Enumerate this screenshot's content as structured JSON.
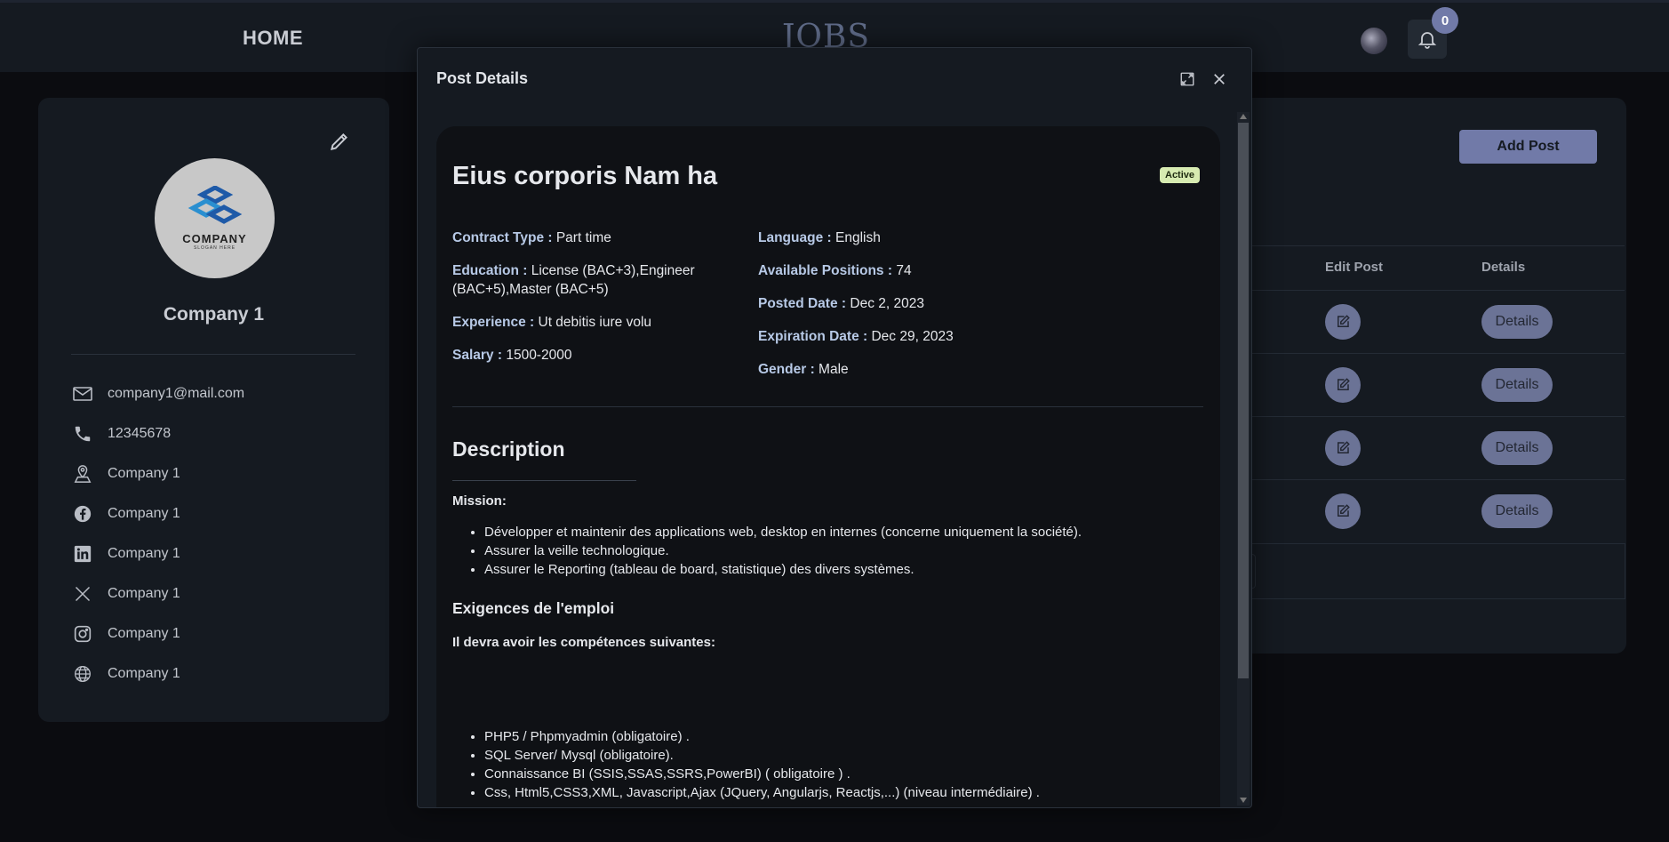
{
  "header": {
    "home_label": "HOME",
    "logo_text": "JOBS",
    "notification_count": "0"
  },
  "profile": {
    "company_name": "Company 1",
    "email": "company1@mail.com",
    "phone": "12345678",
    "address": "Company 1",
    "facebook": "Company 1",
    "linkedin": "Company 1",
    "x": "Company 1",
    "instagram": "Company 1",
    "website": "Company 1",
    "avatar_brand": "COMPANY",
    "avatar_slogan": "SLOGAN HERE"
  },
  "posts_panel": {
    "add_post_label": "Add Post",
    "columns": [
      "Edit Post",
      "Details"
    ],
    "rows": [
      {
        "details_label": "Details"
      },
      {
        "details_label": "Details"
      },
      {
        "details_label": "Details"
      },
      {
        "details_label": "Details"
      }
    ]
  },
  "modal": {
    "title": "Post Details",
    "post": {
      "title": "Eius corporis Nam ha",
      "status": "Active",
      "contract_type_label": "Contract Type :",
      "contract_type": "Part time",
      "education_label": "Education :",
      "education": "License (BAC+3),Engineer (BAC+5),Master (BAC+5)",
      "experience_label": "Experience :",
      "experience": "Ut debitis iure volu",
      "salary_label": "Salary :",
      "salary": "1500-2000",
      "language_label": "Language :",
      "language": "English",
      "positions_label": "Available Positions :",
      "positions": "74",
      "posted_label": "Posted Date :",
      "posted": "Dec 2, 2023",
      "expiration_label": "Expiration Date :",
      "expiration": "Dec 29, 2023",
      "gender_label": "Gender :",
      "gender": "Male"
    },
    "description": {
      "title": "Description",
      "mission_label": "Mission:",
      "mission_items": [
        "Développer et maintenir des applications web, desktop en internes (concerne uniquement la société).",
        "Assurer la veille technologique.",
        "Assurer le Reporting (tableau de board, statistique) des divers systèmes."
      ],
      "requirements_title": "Exigences de l'emploi",
      "skills_intro": "Il devra avoir les compétences suivantes:",
      "skills_items": [
        "PHP5 / Phpmyadmin (obligatoire) .",
        "SQL Server/ Mysql (obligatoire).",
        "Connaissance BI (SSIS,SSAS,SSRS,PowerBI) ( obligatoire ) .",
        "Css, Html5,CSS3,XML, Javascript,Ajax (JQuery, Angularjs, Reactjs,...) (niveau intermédiaire) ."
      ]
    }
  },
  "colors": {
    "accent": "#717aa8",
    "status_active": "#d7ebb1",
    "label_blue": "#b7c9e6"
  }
}
